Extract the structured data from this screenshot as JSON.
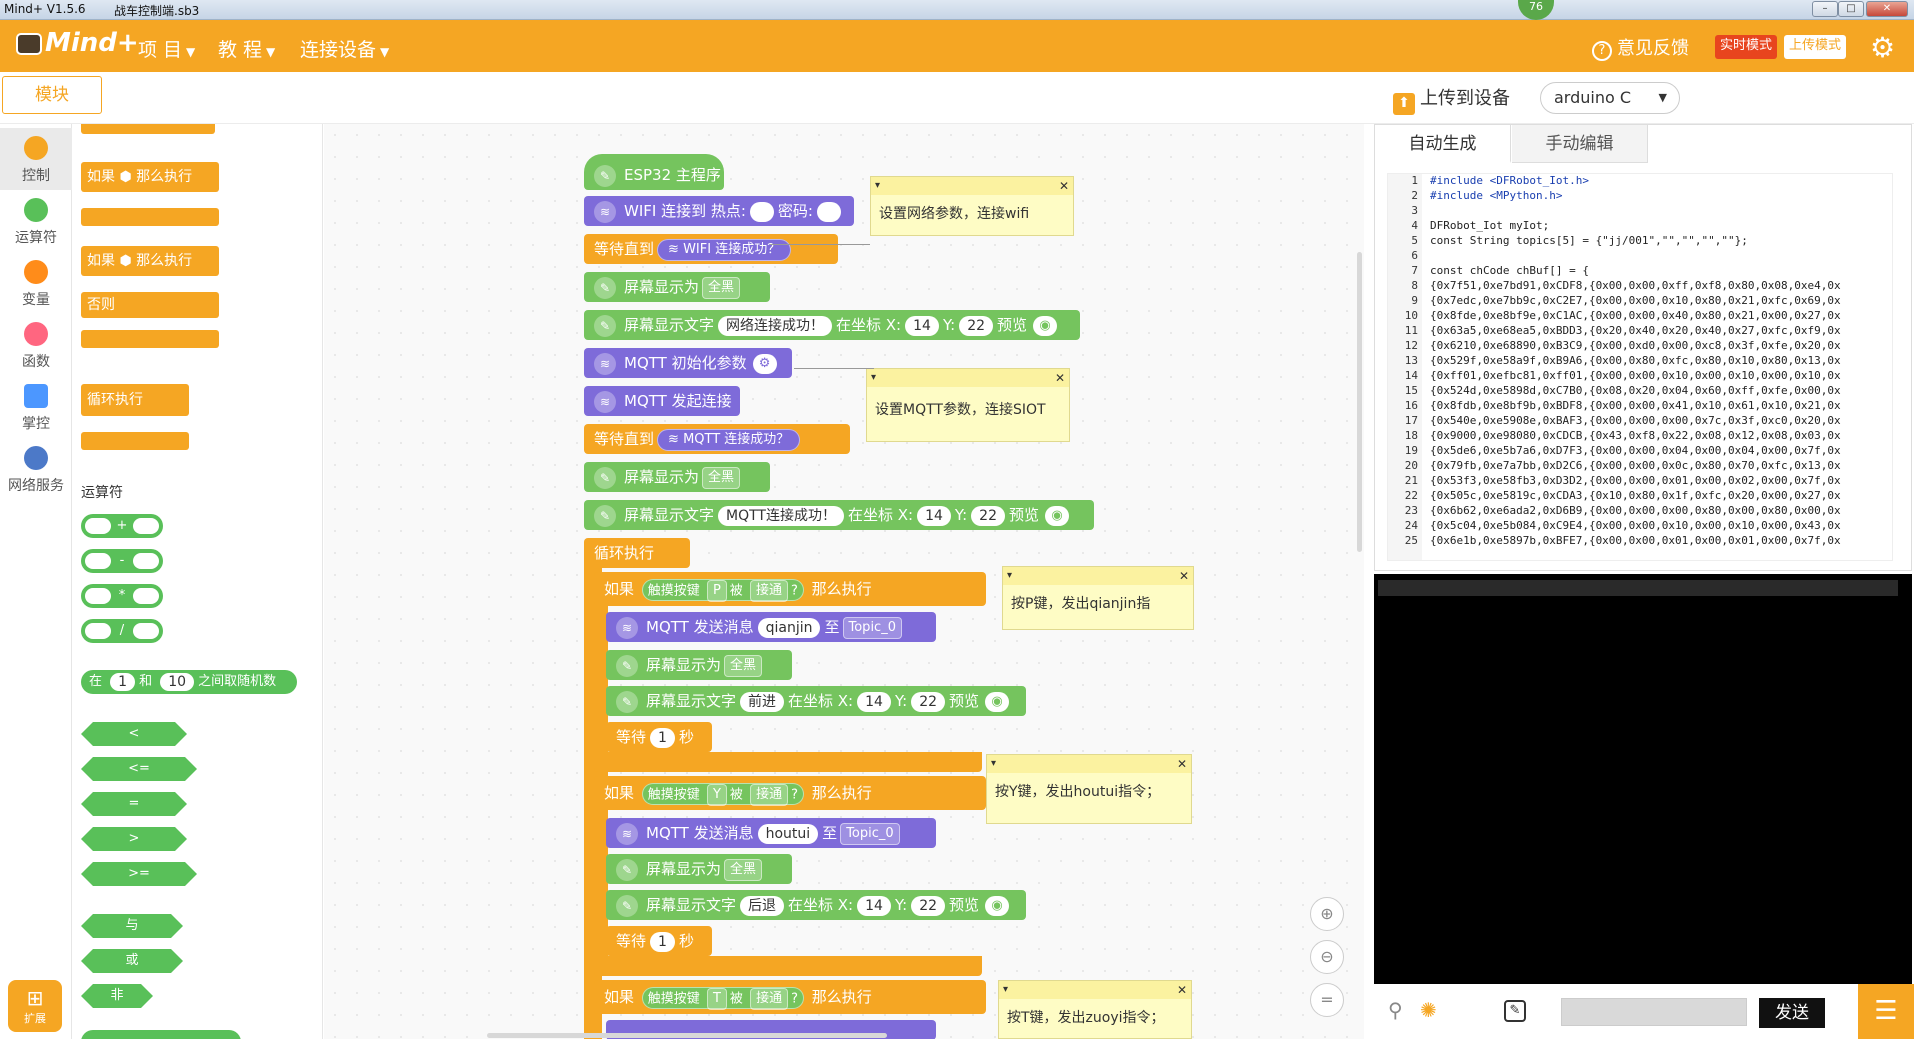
{
  "window": {
    "app": "Mind+ V1.5.6",
    "file": "战车控制端.sb3",
    "badge": "76"
  },
  "menubar": {
    "logo": "Mind+",
    "items": [
      "项 目",
      "教 程",
      "连接设备"
    ],
    "feedback": "意见反馈",
    "realtime": "实时模式",
    "upload_mode": "上传模式"
  },
  "tabs": {
    "blocks": "模块",
    "upload_device": "上传到设备",
    "board": "arduino C"
  },
  "categories": [
    {
      "label": "控制",
      "color": "#f5a623"
    },
    {
      "label": "运算符",
      "color": "#59c059"
    },
    {
      "label": "变量",
      "color": "#ff8c1a"
    },
    {
      "label": "函数",
      "color": "#ff6680"
    },
    {
      "label": "掌控",
      "color": "#4c97ff"
    },
    {
      "label": "网络服务",
      "color": "#4c79c8"
    }
  ],
  "extension": "扩展",
  "palette": {
    "if_then": "如果",
    "then_do": "那么执行",
    "else": "否则",
    "loop": "循环执行",
    "ops_title": "运算符",
    "ops": [
      "+",
      "-",
      "*",
      "/"
    ],
    "random": {
      "in": "在",
      "a": "1",
      "and": "和",
      "b": "10",
      "tail": "之间取随机数"
    },
    "compare": [
      "<",
      "<=",
      "=",
      ">",
      ">="
    ],
    "logic": [
      "与",
      "或",
      "非"
    ]
  },
  "script": {
    "main": "ESP32 主程序",
    "wifi": {
      "label": "WIFI 连接到 热点:",
      "pwd": "密码:"
    },
    "wait_until": "等待直到",
    "wifi_ok": "WIFI 连接成功？",
    "screen_show": "屏幕显示为",
    "full_black": "全黑",
    "screen_text": "屏幕显示文字",
    "text1": "网络连接成功！",
    "at_x": "在坐标 X:",
    "x": "14",
    "y_label": "Y:",
    "y": "22",
    "preview": "预览",
    "mqtt_init": "MQTT 初始化参数",
    "mqtt_connect": "MQTT 发起连接",
    "mqtt_ok": "MQTT 连接成功？",
    "text2": "MQTT连接成功！",
    "loop": "循环执行",
    "if": "如果",
    "touch_key": "触摸按键",
    "pressed": "被",
    "state": "接通",
    "q": "?",
    "then_do": "那么执行",
    "mqtt_send": "MQTT 发送消息",
    "to": "至",
    "topic": "Topic_0",
    "wait": "等待",
    "sec": "1",
    "sec_unit": "秒",
    "keys": [
      "P",
      "Y",
      "T"
    ],
    "msgs": [
      "qianjin",
      "houtui"
    ],
    "words": [
      "前进",
      "后退"
    ]
  },
  "comments": [
    "设置网络参数，连接wifi",
    "设置MQTT参数，连接SIOT",
    "按P键，发出qianjin指",
    "按Y键，发出houtui指令；",
    "按T键，发出zuoyi指令；"
  ],
  "code_tabs": [
    "自动生成",
    "手动编辑"
  ],
  "code_lines": [
    "#include <DFRobot_Iot.h>",
    "#include <MPython.h>",
    "",
    "DFRobot_Iot myIot;",
    "const String topics[5] = {\"jj/001\",\"\",\"\",\"\",\"\"};",
    "",
    "const chCode chBuf[] = {",
    "{0x7f51,0xe7bd91,0xCDF8,{0x00,0x00,0xff,0xf8,0x80,0x08,0xe4,0x",
    "{0x7edc,0xe7bb9c,0xC2E7,{0x00,0x00,0x10,0x80,0x21,0xfc,0x69,0x",
    "{0x8fde,0xe8bf9e,0xC1AC,{0x00,0x00,0x40,0x80,0x21,0x00,0x27,0x",
    "{0x63a5,0xe68ea5,0xBDD3,{0x20,0x40,0x20,0x40,0x27,0xfc,0xf9,0x",
    "{0x6210,0xe68890,0xB3C9,{0x00,0xd0,0x00,0xc8,0x3f,0xfe,0x20,0x",
    "{0x529f,0xe58a9f,0xB9A6,{0x00,0x80,0xfc,0x80,0x10,0x80,0x13,0x",
    "{0xff01,0xefbc81,0xff01,{0x00,0x00,0x10,0x00,0x10,0x00,0x10,0x",
    "{0x524d,0xe5898d,0xC7B0,{0x08,0x20,0x04,0x60,0xff,0xfe,0x00,0x",
    "{0x8fdb,0xe8bf9b,0xBDF8,{0x00,0x00,0x41,0x10,0x61,0x10,0x21,0x",
    "{0x540e,0xe5908e,0xBAF3,{0x00,0x00,0x00,0x7c,0x3f,0xc0,0x20,0x",
    "{0x9000,0xe98080,0xCDCB,{0x43,0xf8,0x22,0x08,0x12,0x08,0x03,0x",
    "{0x5de6,0xe5b7a6,0xD7F3,{0x00,0x00,0x04,0x00,0x04,0x00,0x7f,0x",
    "{0x79fb,0xe7a7bb,0xD2C6,{0x00,0x00,0x0c,0x80,0x70,0xfc,0x13,0x",
    "{0x53f3,0xe58fb3,0xD3D2,{0x00,0x00,0x01,0x00,0x02,0x00,0x7f,0x",
    "{0x505c,0xe5819c,0xCDA3,{0x10,0x80,0x1f,0xfc,0x20,0x00,0x27,0x",
    "{0x6b62,0xe6ada2,0xD6B9,{0x00,0x00,0x00,0x80,0x00,0x80,0x00,0x",
    "{0x5c04,0xe5b084,0xC9E4,{0x00,0x00,0x10,0x00,0x10,0x00,0x43,0x",
    "{0x6e1b,0xe5897b,0xBFE7,{0x00,0x00,0x01,0x00,0x01,0x00,0x7f,0x"
  ],
  "serial": {
    "send": "发送"
  }
}
